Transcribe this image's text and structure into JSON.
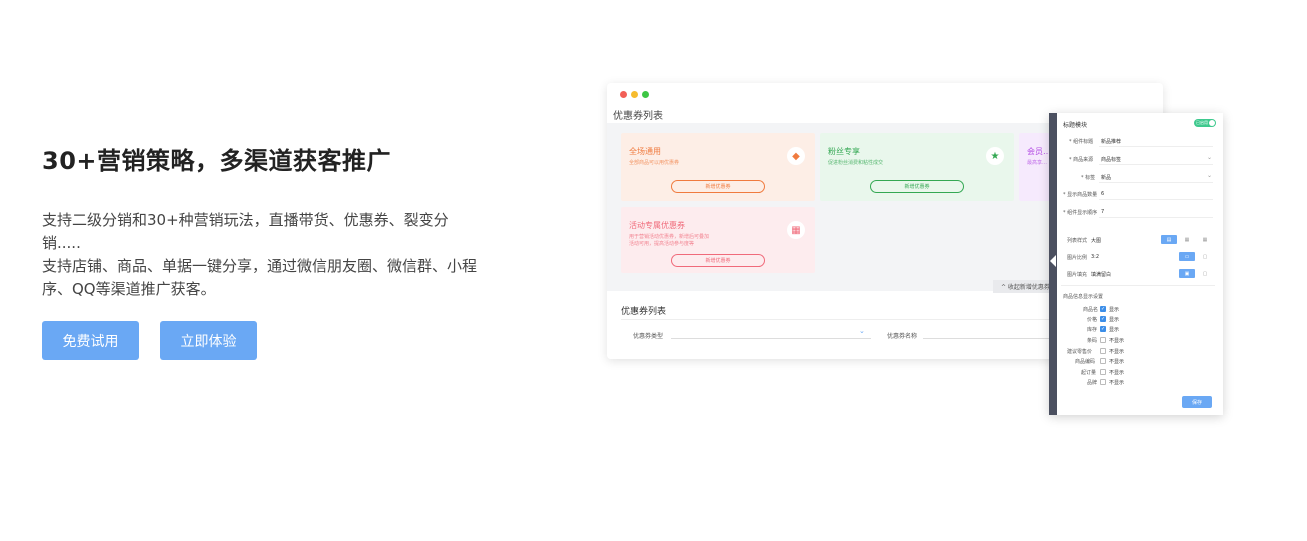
{
  "hero": {
    "title": "30+营销策略，多渠道获客推广",
    "desc_line1": "支持二级分销和30+种营销玩法，直播带货、优惠券、裂变分销.....",
    "desc_line2": "支持店铺、商品、单据一键分享，通过微信朋友圈、微信群、小程序、QQ等渠道推广获客。",
    "btn_trial": "免费试用",
    "btn_experience": "立即体验"
  },
  "mock": {
    "title": "优惠券列表",
    "cards": [
      {
        "title": "全场通用",
        "sub": "全部商品可以用优惠券",
        "btn": "新增优惠券",
        "icon": "◆"
      },
      {
        "title": "粉丝专享",
        "sub": "促进粉丝消费和粘性成交",
        "btn": "新增优惠券",
        "icon": "★"
      },
      {
        "title": "会员…",
        "sub": "最高享…"
      },
      {
        "title": "活动专属优惠券",
        "sub1": "用于营销活动优惠券，新增后可叠加",
        "sub2": "活动可用，提高活动参与度等",
        "btn": "新增优惠券",
        "icon": "▦"
      }
    ],
    "collapse_label": "^ 收起新增优惠券",
    "sub_title": "优惠券列表",
    "filter_type_label": "优惠券类型",
    "filter_name_label": "优惠券名称"
  },
  "panel": {
    "title": "标题模块",
    "toggle": "已启用",
    "rows": [
      {
        "label": "* 组件标题",
        "value": "新品推荐"
      },
      {
        "label": "* 商品来源",
        "value": "商品标签"
      },
      {
        "label": "* 标签",
        "value": "新品"
      },
      {
        "label": "* 显示商品数量",
        "value": "6"
      },
      {
        "label": "* 组件显示顺序",
        "value": "7"
      }
    ],
    "layout_label": "列表样式",
    "layout_value": "大图",
    "ratio_label": "图片比例",
    "ratio_value": "3:2",
    "fill_label": "图片填充",
    "fill_value": "填满留白",
    "info_section": "商品信息显示设置",
    "info_items": [
      {
        "label": "商品名",
        "state": "显示",
        "on": true
      },
      {
        "label": "价格",
        "state": "显示",
        "on": true
      },
      {
        "label": "库存",
        "state": "显示",
        "on": true
      },
      {
        "label": "条码",
        "state": "不显示",
        "on": false
      },
      {
        "label": "建议零售价",
        "state": "不显示",
        "on": false
      },
      {
        "label": "商品编码",
        "state": "不显示",
        "on": false
      },
      {
        "label": "起订量",
        "state": "不显示",
        "on": false
      },
      {
        "label": "品牌",
        "state": "不显示",
        "on": false
      }
    ],
    "save": "保存"
  }
}
